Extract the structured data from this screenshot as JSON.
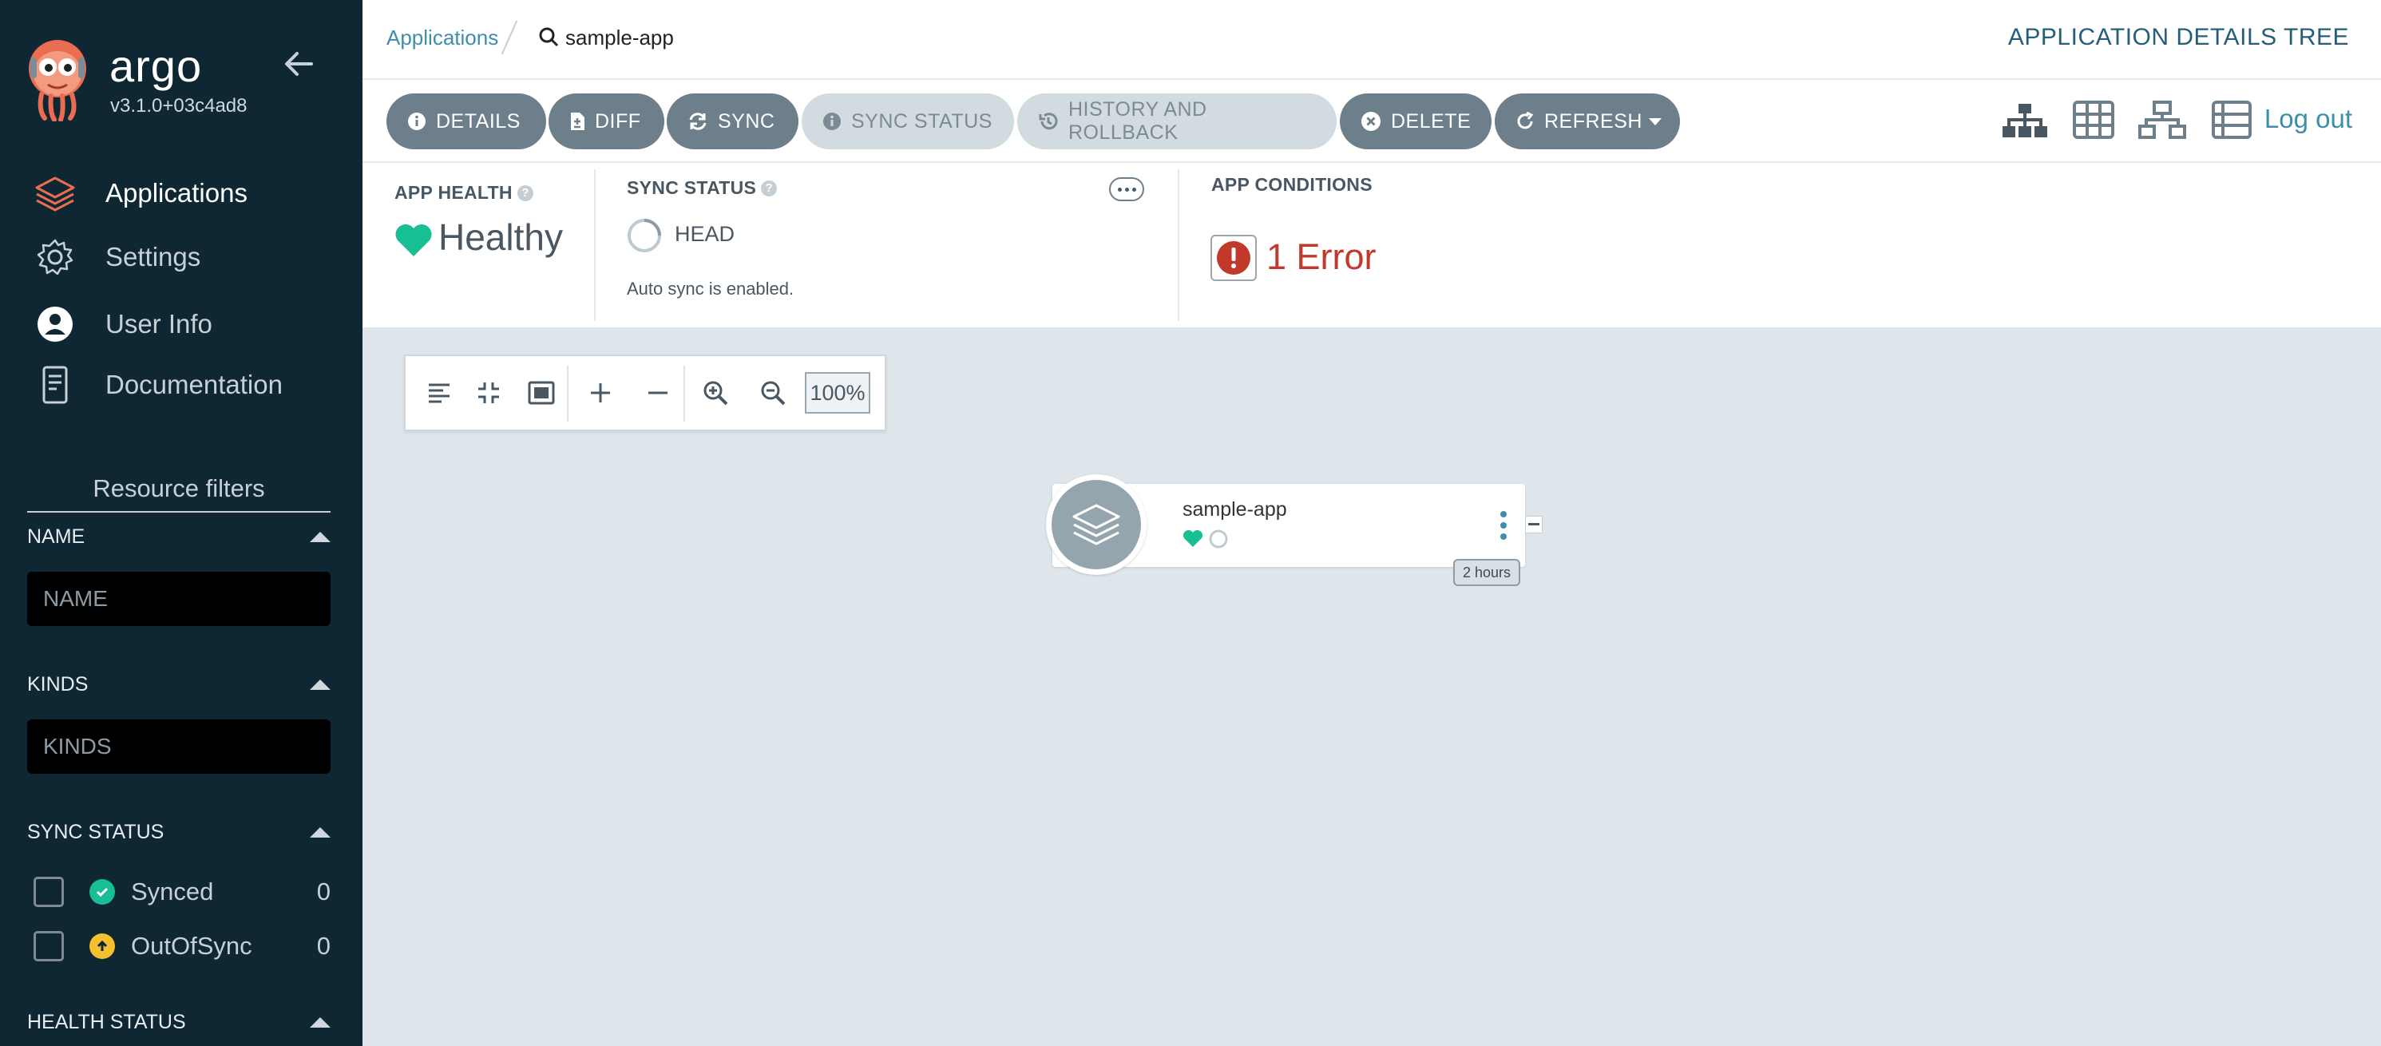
{
  "sidebar": {
    "brand": "argo",
    "version": "v3.1.0+03c4ad8",
    "nav": [
      {
        "label": "Applications",
        "icon": "layers-icon"
      },
      {
        "label": "Settings",
        "icon": "gear-icon"
      },
      {
        "label": "User Info",
        "icon": "user-circle-icon"
      },
      {
        "label": "Documentation",
        "icon": "book-icon"
      }
    ],
    "filters": {
      "title": "Resource filters",
      "name": {
        "label": "NAME",
        "placeholder": "NAME"
      },
      "kinds": {
        "label": "KINDS",
        "placeholder": "KINDS"
      },
      "sync_status": {
        "label": "SYNC STATUS",
        "items": [
          {
            "label": "Synced",
            "count": "0",
            "color": "#18be94"
          },
          {
            "label": "OutOfSync",
            "count": "0",
            "color": "#f4c030"
          }
        ]
      },
      "health_status": {
        "label": "HEALTH STATUS"
      }
    }
  },
  "breadcrumb": {
    "apps": "Applications",
    "current": "sample-app"
  },
  "view_title": "APPLICATION DETAILS TREE",
  "toolbar": {
    "details": "DETAILS",
    "diff": "DIFF",
    "sync": "SYNC",
    "sync_status": "SYNC STATUS",
    "history": "HISTORY AND ROLLBACK",
    "delete": "DELETE",
    "refresh": "REFRESH",
    "logout": "Log out"
  },
  "status": {
    "health_label": "APP HEALTH",
    "health_value": "Healthy",
    "sync_label": "SYNC STATUS",
    "sync_revision": "HEAD",
    "auto_sync": "Auto sync is enabled.",
    "conditions_label": "APP CONDITIONS",
    "conditions_value": "1 Error"
  },
  "graph": {
    "zoom": "100%",
    "node": {
      "name": "sample-app",
      "age": "2 hours"
    }
  },
  "colors": {
    "sidebar_bg": "#0f2733",
    "accent": "#3d8ea8",
    "healthy": "#18be94",
    "error": "#c0392b",
    "button": "#6d7f8b"
  }
}
